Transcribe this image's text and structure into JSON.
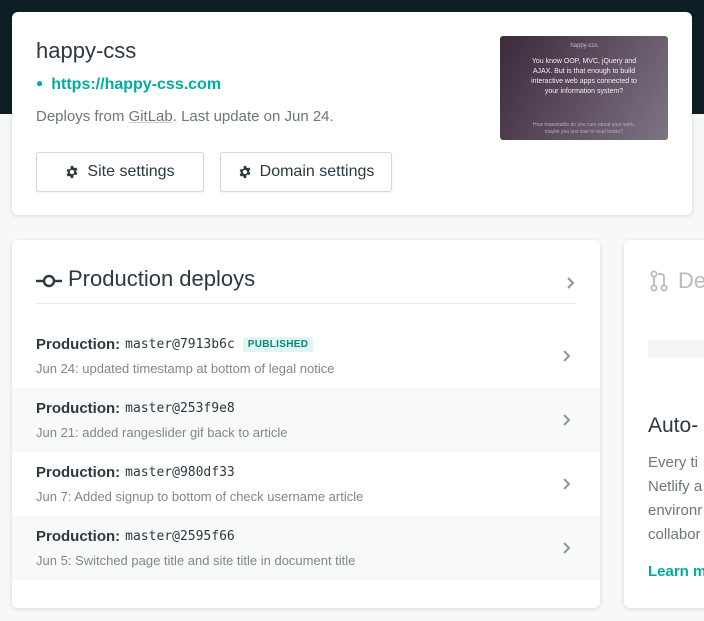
{
  "site": {
    "name": "happy-css",
    "url": "https://happy-css.com",
    "deploy_prefix": "Deploys from ",
    "provider": "GitLab",
    "deploy_suffix": ". Last update on Jun 24.",
    "site_settings_label": "Site settings",
    "domain_settings_label": "Domain settings",
    "preview": {
      "header": "happy-css",
      "headline": "You know OOP, MVC, jQuery and AJAX. But is that enough to build interactive web apps connected to your information system?",
      "footer": "How reasonable do you care about your work, maybe you just love to read books?"
    }
  },
  "deploys": {
    "title": "Production deploys",
    "items": [
      {
        "context": "Production:",
        "ref": "master@7913b6c",
        "badge": "PUBLISHED",
        "message": "Jun 24: updated timestamp at bottom of legal notice"
      },
      {
        "context": "Production:",
        "ref": "master@253f9e8",
        "badge": "",
        "message": "Jun 21: added rangeslider gif back to article"
      },
      {
        "context": "Production:",
        "ref": "master@980df33",
        "badge": "",
        "message": "Jun 7: Added signup to bottom of check username article"
      },
      {
        "context": "Production:",
        "ref": "master@2595f66",
        "badge": "",
        "message": "Jun 5: Switched page title and site title in document title"
      }
    ]
  },
  "side": {
    "title_partial": "De",
    "heading_partial": "Auto-",
    "text_lines": [
      "Every ti",
      "Netlify a",
      "environr",
      "collabor"
    ],
    "link_partial": "Learn m"
  },
  "colors": {
    "accent": "#00ad9f",
    "header_bg": "#0e1e25",
    "badge_bg": "#e3f5f3",
    "badge_text": "#00897c"
  }
}
